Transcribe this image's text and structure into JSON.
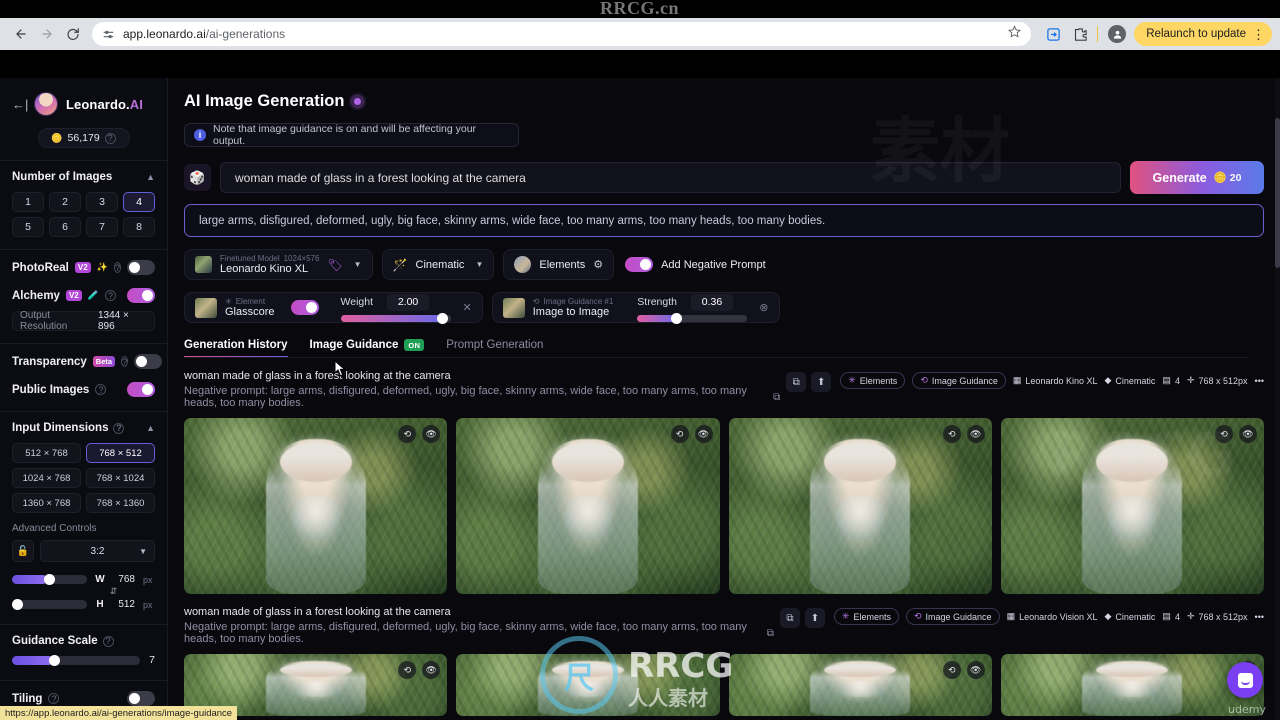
{
  "browser": {
    "url_host": "app.leonardo.ai",
    "url_path": "/ai-generations",
    "relaunch_label": "Relaunch to update",
    "status_link": "https://app.leonardo.ai/ai-generations/image-guidance",
    "watermark_top": "RRCG.cn"
  },
  "sidebar": {
    "brand": "Leonardo.",
    "brand_suffix": "AI",
    "credits": "56,179",
    "number_of_images": {
      "title": "Number of Images",
      "options": [
        "1",
        "2",
        "3",
        "4",
        "5",
        "6",
        "7",
        "8"
      ],
      "selected": "4"
    },
    "photoreal": {
      "label": "PhotoReal",
      "badge": "V2",
      "state": "off"
    },
    "alchemy": {
      "label": "Alchemy",
      "badge": "V2",
      "state": "on"
    },
    "output_resolution": {
      "label": "Output Resolution",
      "value": "1344 × 896"
    },
    "transparency": {
      "label": "Transparency",
      "badge": "Beta",
      "state": "off"
    },
    "public_images": {
      "label": "Public Images",
      "state": "on"
    },
    "input_dimensions": {
      "title": "Input Dimensions",
      "options": [
        "512 × 768",
        "768 × 512",
        "1024 × 768",
        "768 × 1024",
        "1360 × 768",
        "768 × 1360"
      ],
      "selected": "768 × 512"
    },
    "advanced_controls": {
      "label": "Advanced Controls",
      "aspect_ratio": "3:2",
      "width": {
        "label": "W",
        "value": "768",
        "unit": "px"
      },
      "height": {
        "label": "H",
        "value": "512",
        "unit": "px"
      }
    },
    "guidance_scale": {
      "label": "Guidance Scale",
      "value": "7"
    },
    "tiling": {
      "label": "Tiling",
      "state": "off"
    }
  },
  "main": {
    "page_title": "AI Image Generation",
    "note": "Note that image guidance is on and will be affecting your output.",
    "prompt": "woman made of glass in a forest looking at the camera",
    "generate_label": "Generate",
    "generate_cost": "20",
    "negative_prompt": "large arms, disfigured, deformed, ugly, big face, skinny arms, wide face, too many arms, too many heads, too many bodies.",
    "model_chip": {
      "sub_label": "Finetuned Model",
      "dimensions": "1024×576",
      "name": "Leonardo Kino XL"
    },
    "style_chip": {
      "name": "Cinematic"
    },
    "elements_chip": {
      "name": "Elements"
    },
    "negative_toggle": {
      "label": "Add Negative Prompt",
      "state": "on"
    },
    "element_card": {
      "sub_label": "Element",
      "name": "Glasscore",
      "toggle_state": "on",
      "slider_label": "Weight",
      "slider_value": "2.00"
    },
    "guidance_card": {
      "sub_label": "Image Guidance #1",
      "name": "Image to Image",
      "slider_label": "Strength",
      "slider_value": "0.36"
    },
    "tabs": [
      {
        "label": "Generation History",
        "active": true,
        "badge": ""
      },
      {
        "label": "Image Guidance",
        "active": false,
        "badge": "ON"
      },
      {
        "label": "Prompt Generation",
        "active": false,
        "badge": ""
      }
    ],
    "results": [
      {
        "prompt": "woman made of glass in a forest looking at the camera",
        "negative_prompt_prefix": "Negative prompt:",
        "negative_prompt": "large arms, disfigured, deformed, ugly, big face, skinny arms, wide face, too many arms, too many heads, too many bodies.",
        "badges": [
          "Elements",
          "Image Guidance",
          "Leonardo Kino XL",
          "Cinematic",
          "4",
          "768 x 512px",
          "•••"
        ],
        "image_count": 4
      },
      {
        "prompt": "woman made of glass in a forest looking at the camera",
        "negative_prompt_prefix": "Negative prompt:",
        "negative_prompt": "large arms, disfigured, deformed, ugly, big face, skinny arms, wide face, too many arms, too many heads, too many bodies.",
        "badges": [
          "Elements",
          "Image Guidance",
          "Leonardo Vision XL",
          "Cinematic",
          "4",
          "768 x 512px",
          "•••"
        ],
        "image_count": 4
      }
    ]
  },
  "overlay": {
    "watermark_rrcg": "RRCG",
    "watermark_cn": "人人素材",
    "udemy": "udemy"
  },
  "colors": {
    "accent_purple": "#b066e6",
    "generate_gradient_start": "#e0527f",
    "generate_gradient_end": "#5a7be8",
    "on_badge_green": "#1f9e55",
    "relaunch_yellow": "#fdd663"
  }
}
